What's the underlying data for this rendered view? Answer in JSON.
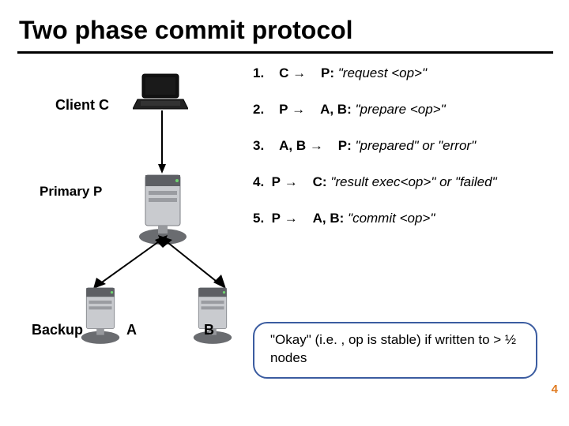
{
  "title": "Two phase commit protocol",
  "labels": {
    "client": "Client C",
    "primary": "Primary P",
    "backup": "Backup",
    "a": "A",
    "b": "B"
  },
  "steps": [
    {
      "num": "1.",
      "from": "C",
      "to": "P:",
      "msg": "\"request <op>\""
    },
    {
      "num": "2.",
      "from": "P",
      "to": "A, B:",
      "msg": "\"prepare <op>\""
    },
    {
      "num": "3.",
      "from": "A, B",
      "to": "P:",
      "msg": "\"prepared\" or \"error\""
    },
    {
      "num": "4.",
      "from": "P",
      "to": "C:",
      "msg": "\"result exec<op>\" or \"failed\""
    },
    {
      "num": "5.",
      "from": "P",
      "to": "A, B:",
      "msg": "\"commit <op>\""
    }
  ],
  "callout": "\"Okay\" (i.e. , op is stable) if written to > ½ nodes",
  "slide_number": "4",
  "arrow_glyph": "→"
}
